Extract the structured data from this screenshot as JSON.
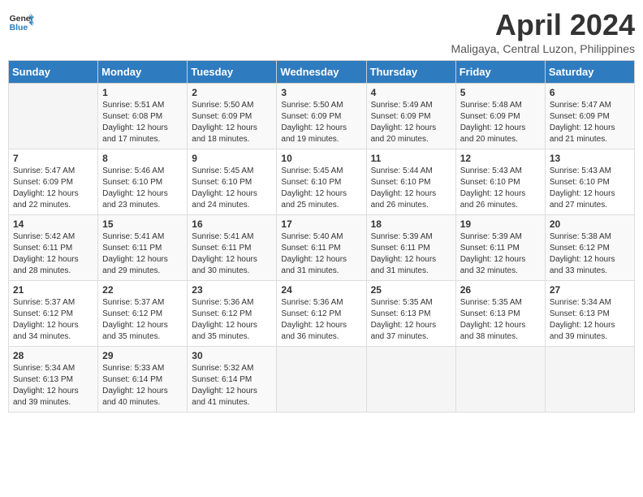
{
  "header": {
    "logo_line1": "General",
    "logo_line2": "Blue",
    "month_title": "April 2024",
    "location": "Maligaya, Central Luzon, Philippines"
  },
  "days_of_week": [
    "Sunday",
    "Monday",
    "Tuesday",
    "Wednesday",
    "Thursday",
    "Friday",
    "Saturday"
  ],
  "weeks": [
    [
      {
        "day": "",
        "sunrise": "",
        "sunset": "",
        "daylight": "",
        "empty": true
      },
      {
        "day": "1",
        "sunrise": "Sunrise: 5:51 AM",
        "sunset": "Sunset: 6:08 PM",
        "daylight": "Daylight: 12 hours and 17 minutes."
      },
      {
        "day": "2",
        "sunrise": "Sunrise: 5:50 AM",
        "sunset": "Sunset: 6:09 PM",
        "daylight": "Daylight: 12 hours and 18 minutes."
      },
      {
        "day": "3",
        "sunrise": "Sunrise: 5:50 AM",
        "sunset": "Sunset: 6:09 PM",
        "daylight": "Daylight: 12 hours and 19 minutes."
      },
      {
        "day": "4",
        "sunrise": "Sunrise: 5:49 AM",
        "sunset": "Sunset: 6:09 PM",
        "daylight": "Daylight: 12 hours and 20 minutes."
      },
      {
        "day": "5",
        "sunrise": "Sunrise: 5:48 AM",
        "sunset": "Sunset: 6:09 PM",
        "daylight": "Daylight: 12 hours and 20 minutes."
      },
      {
        "day": "6",
        "sunrise": "Sunrise: 5:47 AM",
        "sunset": "Sunset: 6:09 PM",
        "daylight": "Daylight: 12 hours and 21 minutes."
      }
    ],
    [
      {
        "day": "7",
        "sunrise": "Sunrise: 5:47 AM",
        "sunset": "Sunset: 6:09 PM",
        "daylight": "Daylight: 12 hours and 22 minutes."
      },
      {
        "day": "8",
        "sunrise": "Sunrise: 5:46 AM",
        "sunset": "Sunset: 6:10 PM",
        "daylight": "Daylight: 12 hours and 23 minutes."
      },
      {
        "day": "9",
        "sunrise": "Sunrise: 5:45 AM",
        "sunset": "Sunset: 6:10 PM",
        "daylight": "Daylight: 12 hours and 24 minutes."
      },
      {
        "day": "10",
        "sunrise": "Sunrise: 5:45 AM",
        "sunset": "Sunset: 6:10 PM",
        "daylight": "Daylight: 12 hours and 25 minutes."
      },
      {
        "day": "11",
        "sunrise": "Sunrise: 5:44 AM",
        "sunset": "Sunset: 6:10 PM",
        "daylight": "Daylight: 12 hours and 26 minutes."
      },
      {
        "day": "12",
        "sunrise": "Sunrise: 5:43 AM",
        "sunset": "Sunset: 6:10 PM",
        "daylight": "Daylight: 12 hours and 26 minutes."
      },
      {
        "day": "13",
        "sunrise": "Sunrise: 5:43 AM",
        "sunset": "Sunset: 6:10 PM",
        "daylight": "Daylight: 12 hours and 27 minutes."
      }
    ],
    [
      {
        "day": "14",
        "sunrise": "Sunrise: 5:42 AM",
        "sunset": "Sunset: 6:11 PM",
        "daylight": "Daylight: 12 hours and 28 minutes."
      },
      {
        "day": "15",
        "sunrise": "Sunrise: 5:41 AM",
        "sunset": "Sunset: 6:11 PM",
        "daylight": "Daylight: 12 hours and 29 minutes."
      },
      {
        "day": "16",
        "sunrise": "Sunrise: 5:41 AM",
        "sunset": "Sunset: 6:11 PM",
        "daylight": "Daylight: 12 hours and 30 minutes."
      },
      {
        "day": "17",
        "sunrise": "Sunrise: 5:40 AM",
        "sunset": "Sunset: 6:11 PM",
        "daylight": "Daylight: 12 hours and 31 minutes."
      },
      {
        "day": "18",
        "sunrise": "Sunrise: 5:39 AM",
        "sunset": "Sunset: 6:11 PM",
        "daylight": "Daylight: 12 hours and 31 minutes."
      },
      {
        "day": "19",
        "sunrise": "Sunrise: 5:39 AM",
        "sunset": "Sunset: 6:11 PM",
        "daylight": "Daylight: 12 hours and 32 minutes."
      },
      {
        "day": "20",
        "sunrise": "Sunrise: 5:38 AM",
        "sunset": "Sunset: 6:12 PM",
        "daylight": "Daylight: 12 hours and 33 minutes."
      }
    ],
    [
      {
        "day": "21",
        "sunrise": "Sunrise: 5:37 AM",
        "sunset": "Sunset: 6:12 PM",
        "daylight": "Daylight: 12 hours and 34 minutes."
      },
      {
        "day": "22",
        "sunrise": "Sunrise: 5:37 AM",
        "sunset": "Sunset: 6:12 PM",
        "daylight": "Daylight: 12 hours and 35 minutes."
      },
      {
        "day": "23",
        "sunrise": "Sunrise: 5:36 AM",
        "sunset": "Sunset: 6:12 PM",
        "daylight": "Daylight: 12 hours and 35 minutes."
      },
      {
        "day": "24",
        "sunrise": "Sunrise: 5:36 AM",
        "sunset": "Sunset: 6:12 PM",
        "daylight": "Daylight: 12 hours and 36 minutes."
      },
      {
        "day": "25",
        "sunrise": "Sunrise: 5:35 AM",
        "sunset": "Sunset: 6:13 PM",
        "daylight": "Daylight: 12 hours and 37 minutes."
      },
      {
        "day": "26",
        "sunrise": "Sunrise: 5:35 AM",
        "sunset": "Sunset: 6:13 PM",
        "daylight": "Daylight: 12 hours and 38 minutes."
      },
      {
        "day": "27",
        "sunrise": "Sunrise: 5:34 AM",
        "sunset": "Sunset: 6:13 PM",
        "daylight": "Daylight: 12 hours and 39 minutes."
      }
    ],
    [
      {
        "day": "28",
        "sunrise": "Sunrise: 5:34 AM",
        "sunset": "Sunset: 6:13 PM",
        "daylight": "Daylight: 12 hours and 39 minutes."
      },
      {
        "day": "29",
        "sunrise": "Sunrise: 5:33 AM",
        "sunset": "Sunset: 6:14 PM",
        "daylight": "Daylight: 12 hours and 40 minutes."
      },
      {
        "day": "30",
        "sunrise": "Sunrise: 5:32 AM",
        "sunset": "Sunset: 6:14 PM",
        "daylight": "Daylight: 12 hours and 41 minutes."
      },
      {
        "day": "",
        "sunrise": "",
        "sunset": "",
        "daylight": "",
        "empty": true
      },
      {
        "day": "",
        "sunrise": "",
        "sunset": "",
        "daylight": "",
        "empty": true
      },
      {
        "day": "",
        "sunrise": "",
        "sunset": "",
        "daylight": "",
        "empty": true
      },
      {
        "day": "",
        "sunrise": "",
        "sunset": "",
        "daylight": "",
        "empty": true
      }
    ]
  ]
}
